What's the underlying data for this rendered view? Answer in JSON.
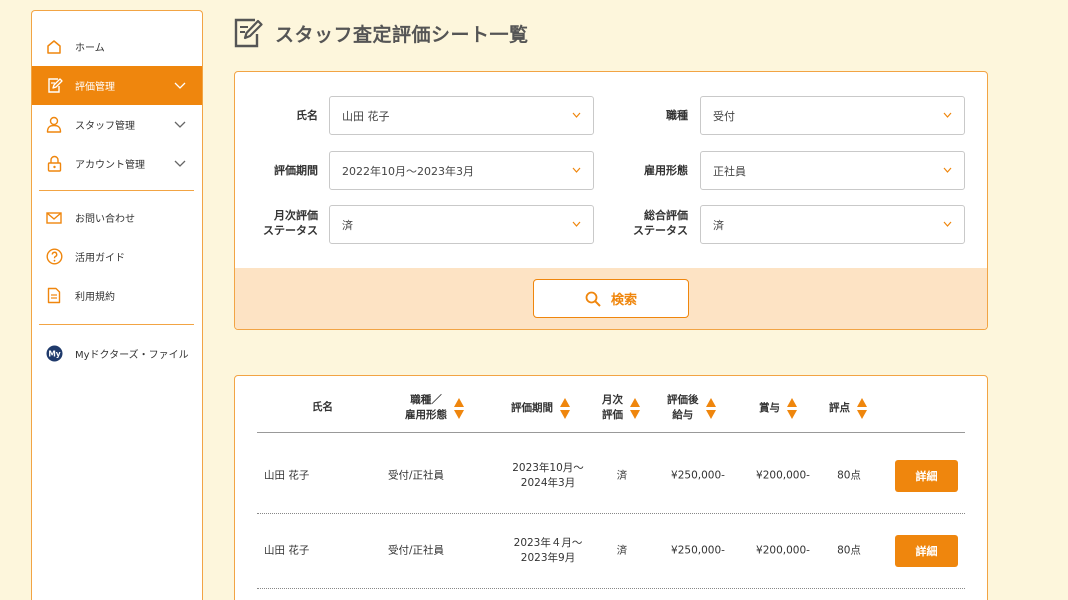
{
  "sidebar": {
    "items": [
      {
        "label": "ホーム",
        "icon": "home-icon"
      },
      {
        "label": "評価管理",
        "icon": "edit-icon",
        "active": true,
        "expandable": true
      },
      {
        "label": "スタッフ管理",
        "icon": "person-icon",
        "expandable": true
      },
      {
        "label": "アカウント管理",
        "icon": "lock-icon",
        "expandable": true
      },
      {
        "label": "お問い合わせ",
        "icon": "mail-icon"
      },
      {
        "label": "活用ガイド",
        "icon": "question-icon"
      },
      {
        "label": "利用規約",
        "icon": "document-icon"
      },
      {
        "label": "Myドクターズ・ファイル",
        "icon": "my-logo-icon",
        "logo_text": "My"
      }
    ]
  },
  "header": {
    "title": "スタッフ査定評価シート一覧",
    "icon": "edit-icon"
  },
  "filters": {
    "name": {
      "label": "氏名",
      "value": "山田 花子"
    },
    "job": {
      "label": "職種",
      "value": "受付"
    },
    "period": {
      "label": "評価期間",
      "value": "2022年10月〜2023年3月"
    },
    "employment": {
      "label": "雇用形態",
      "value": "正社員"
    },
    "monthly": {
      "label_1": "月次評価",
      "label_2": "ステータス",
      "value": "済"
    },
    "overall": {
      "label_1": "総合評価",
      "label_2": "ステータス",
      "value": "済"
    }
  },
  "search": {
    "label": "検索",
    "icon": "search-icon"
  },
  "table": {
    "headers": {
      "name": "氏名",
      "job_1": "職種／",
      "job_2": "雇用形態",
      "period": "評価期間",
      "monthly_1": "月次",
      "monthly_2": "評価",
      "salary_1": "評価後",
      "salary_2": "給与",
      "bonus": "賞与",
      "score": "評点"
    },
    "rows": [
      {
        "name": "山田 花子",
        "job": "受付/正社員",
        "period_1": "2023年10月〜",
        "period_2": "2024年3月",
        "monthly": "済",
        "salary": "¥250,000-",
        "bonus": "¥200,000-",
        "score": "80点",
        "action": "詳細"
      },
      {
        "name": "山田 花子",
        "job": "受付/正社員",
        "period_1": "2023年４月〜",
        "period_2": "2023年9月",
        "monthly": "済",
        "salary": "¥250,000-",
        "bonus": "¥200,000-",
        "score": "80点",
        "action": "詳細"
      }
    ]
  },
  "colors": {
    "accent": "#ef860d",
    "border": "#f2a444",
    "band": "#fde3c4",
    "background": "#fdf6dc",
    "text": "#333333"
  }
}
